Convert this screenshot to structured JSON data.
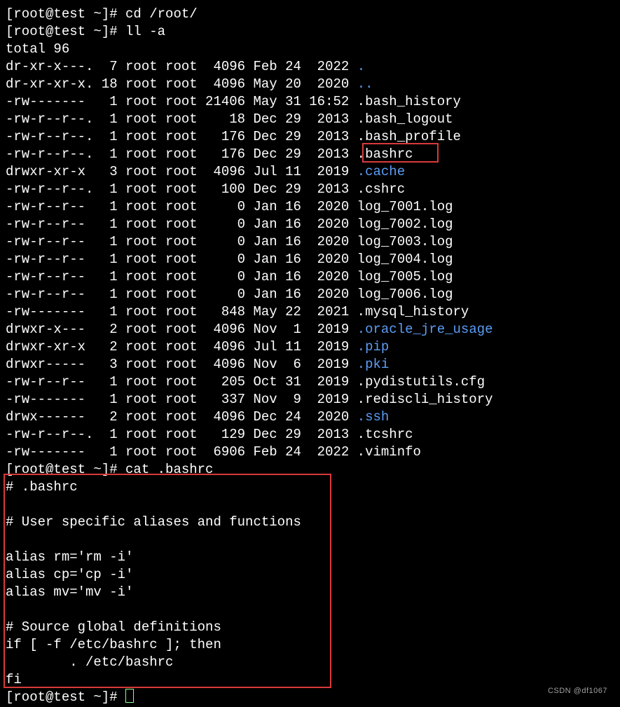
{
  "prompt_a": "[root@test ~]# ",
  "cmd1": "cd /root/",
  "cmd2": "ll -a",
  "total": "total 96",
  "rows": [
    {
      "perm": "dr-xr-x---.",
      "n": "  7",
      "u": "root",
      "g": "root",
      "sz": "  4096",
      "d": "Feb 24  2022",
      "name": ".",
      "dir": true
    },
    {
      "perm": "dr-xr-xr-x.",
      "n": " 18",
      "u": "root",
      "g": "root",
      "sz": "  4096",
      "d": "May 20  2020",
      "name": "..",
      "dir": true
    },
    {
      "perm": "-rw-------",
      "n": "   1",
      "u": "root",
      "g": "root",
      "sz": " 21406",
      "d": "May 31 16:52",
      "name": ".bash_history",
      "dir": false
    },
    {
      "perm": "-rw-r--r--.",
      "n": "  1",
      "u": "root",
      "g": "root",
      "sz": "    18",
      "d": "Dec 29  2013",
      "name": ".bash_logout",
      "dir": false
    },
    {
      "perm": "-rw-r--r--.",
      "n": "  1",
      "u": "root",
      "g": "root",
      "sz": "   176",
      "d": "Dec 29  2013",
      "name": ".bash_profile",
      "dir": false
    },
    {
      "perm": "-rw-r--r--.",
      "n": "  1",
      "u": "root",
      "g": "root",
      "sz": "   176",
      "d": "Dec 29  2013",
      "name": ".bashrc",
      "dir": false
    },
    {
      "perm": "drwxr-xr-x",
      "n": "   3",
      "u": "root",
      "g": "root",
      "sz": "  4096",
      "d": "Jul 11  2019",
      "name": ".cache",
      "dir": true
    },
    {
      "perm": "-rw-r--r--.",
      "n": "  1",
      "u": "root",
      "g": "root",
      "sz": "   100",
      "d": "Dec 29  2013",
      "name": ".cshrc",
      "dir": false
    },
    {
      "perm": "-rw-r--r--",
      "n": "   1",
      "u": "root",
      "g": "root",
      "sz": "     0",
      "d": "Jan 16  2020",
      "name": "log_7001.log",
      "dir": false
    },
    {
      "perm": "-rw-r--r--",
      "n": "   1",
      "u": "root",
      "g": "root",
      "sz": "     0",
      "d": "Jan 16  2020",
      "name": "log_7002.log",
      "dir": false
    },
    {
      "perm": "-rw-r--r--",
      "n": "   1",
      "u": "root",
      "g": "root",
      "sz": "     0",
      "d": "Jan 16  2020",
      "name": "log_7003.log",
      "dir": false
    },
    {
      "perm": "-rw-r--r--",
      "n": "   1",
      "u": "root",
      "g": "root",
      "sz": "     0",
      "d": "Jan 16  2020",
      "name": "log_7004.log",
      "dir": false
    },
    {
      "perm": "-rw-r--r--",
      "n": "   1",
      "u": "root",
      "g": "root",
      "sz": "     0",
      "d": "Jan 16  2020",
      "name": "log_7005.log",
      "dir": false
    },
    {
      "perm": "-rw-r--r--",
      "n": "   1",
      "u": "root",
      "g": "root",
      "sz": "     0",
      "d": "Jan 16  2020",
      "name": "log_7006.log",
      "dir": false
    },
    {
      "perm": "-rw-------",
      "n": "   1",
      "u": "root",
      "g": "root",
      "sz": "   848",
      "d": "May 22  2021",
      "name": ".mysql_history",
      "dir": false
    },
    {
      "perm": "drwxr-x---",
      "n": "   2",
      "u": "root",
      "g": "root",
      "sz": "  4096",
      "d": "Nov  1  2019",
      "name": ".oracle_jre_usage",
      "dir": true
    },
    {
      "perm": "drwxr-xr-x",
      "n": "   2",
      "u": "root",
      "g": "root",
      "sz": "  4096",
      "d": "Jul 11  2019",
      "name": ".pip",
      "dir": true
    },
    {
      "perm": "drwxr-----",
      "n": "   3",
      "u": "root",
      "g": "root",
      "sz": "  4096",
      "d": "Nov  6  2019",
      "name": ".pki",
      "dir": true
    },
    {
      "perm": "-rw-r--r--",
      "n": "   1",
      "u": "root",
      "g": "root",
      "sz": "   205",
      "d": "Oct 31  2019",
      "name": ".pydistutils.cfg",
      "dir": false
    },
    {
      "perm": "-rw-------",
      "n": "   1",
      "u": "root",
      "g": "root",
      "sz": "   337",
      "d": "Nov  9  2019",
      "name": ".rediscli_history",
      "dir": false
    },
    {
      "perm": "drwx------",
      "n": "   2",
      "u": "root",
      "g": "root",
      "sz": "  4096",
      "d": "Dec 24  2020",
      "name": ".ssh",
      "dir": true
    },
    {
      "perm": "-rw-r--r--.",
      "n": "  1",
      "u": "root",
      "g": "root",
      "sz": "   129",
      "d": "Dec 29  2013",
      "name": ".tcshrc",
      "dir": false
    },
    {
      "perm": "-rw-------",
      "n": "   1",
      "u": "root",
      "g": "root",
      "sz": "  6906",
      "d": "Feb 24  2022",
      "name": ".viminfo",
      "dir": false
    }
  ],
  "cmd3": "cat .bashrc",
  "file_lines": [
    "# .bashrc",
    "",
    "# User specific aliases and functions",
    "",
    "alias rm='rm -i'",
    "alias cp='cp -i'",
    "alias mv='mv -i'",
    "",
    "# Source global definitions",
    "if [ -f /etc/bashrc ]; then",
    "        . /etc/bashrc",
    "fi"
  ],
  "watermark": "CSDN @df1067"
}
